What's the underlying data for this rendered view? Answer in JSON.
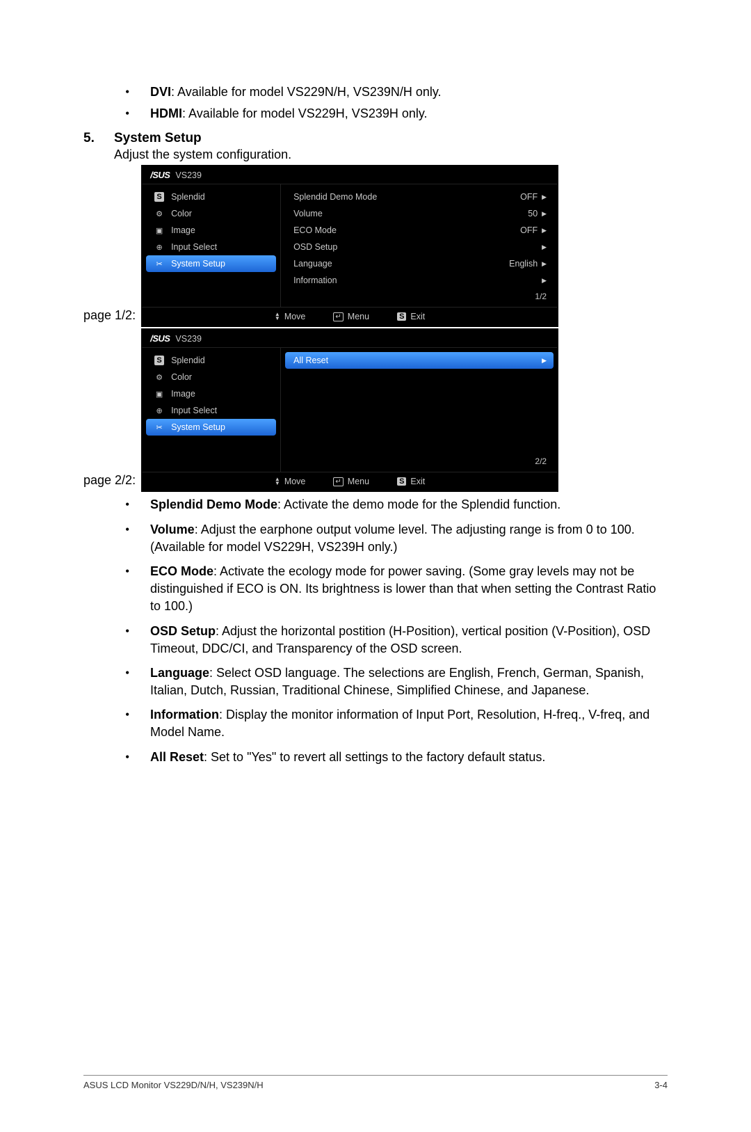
{
  "intro_bullets": [
    {
      "label": "DVI",
      "text": ": Available for model VS229N/H, VS239N/H only."
    },
    {
      "label": "HDMI",
      "text": ": Available for model VS229H, VS239H only."
    }
  ],
  "section": {
    "num": "5.",
    "title": "System Setup",
    "desc": "Adjust the system configuration."
  },
  "page1_label": "page 1/2:",
  "page2_label": "page 2/2:",
  "osd": {
    "brand": "/SUS",
    "model": "VS239",
    "menu": [
      {
        "icon": "S",
        "iconType": "box",
        "label": "Splendid"
      },
      {
        "icon": "⚙",
        "iconType": "glyph",
        "label": "Color"
      },
      {
        "icon": "▣",
        "iconType": "glyph",
        "label": "Image"
      },
      {
        "icon": "⊕",
        "iconType": "glyph",
        "label": "Input Select"
      },
      {
        "icon": "✂",
        "iconType": "glyph",
        "label": "System Setup",
        "selected": true
      }
    ],
    "page1_opts": [
      {
        "name": "Splendid Demo Mode",
        "val": "OFF"
      },
      {
        "name": "Volume",
        "val": "50"
      },
      {
        "name": "ECO Mode",
        "val": "OFF"
      },
      {
        "name": "OSD Setup",
        "val": ""
      },
      {
        "name": "Language",
        "val": "English"
      },
      {
        "name": "Information",
        "val": ""
      }
    ],
    "page1_ind": "1/2",
    "page2_opts": [
      {
        "name": "All Reset",
        "val": "",
        "selected": true
      }
    ],
    "page2_ind": "2/2",
    "footer": {
      "move": "Move",
      "menu": "Menu",
      "exit": "Exit",
      "sbox": "S"
    }
  },
  "descriptions": [
    {
      "label": "Splendid Demo Mode",
      "text": ": Activate the demo mode for the Splendid function."
    },
    {
      "label": "Volume",
      "text": ": Adjust the earphone output volume level. The adjusting range is from 0 to 100.(Available for model VS229H, VS239H only.)"
    },
    {
      "label": "ECO Mode",
      "text": ": Activate the ecology mode for power saving. (Some gray levels may not be distinguished if ECO is ON. Its brightness is lower than that when setting the Contrast Ratio to 100.)"
    },
    {
      "label": "OSD Setup",
      "text": ": Adjust the horizontal postition (H-Position), vertical position (V-Position), OSD Timeout, DDC/CI, and Transparency of the OSD screen."
    },
    {
      "label": "Language",
      "text": ": Select OSD language. The selections are English, French, German, Spanish, Italian, Dutch, Russian, Traditional Chinese, Simplified Chinese, and Japanese."
    },
    {
      "label": "Information",
      "text": ": Display the monitor information of Input Port, Resolution, H-freq., V-freq, and Model Name."
    },
    {
      "label": "All Reset",
      "text": ": Set to \"Yes\" to revert all settings to the factory default status."
    }
  ],
  "footer": {
    "left": "ASUS LCD Monitor VS229D/N/H, VS239N/H",
    "right": "3-4"
  }
}
